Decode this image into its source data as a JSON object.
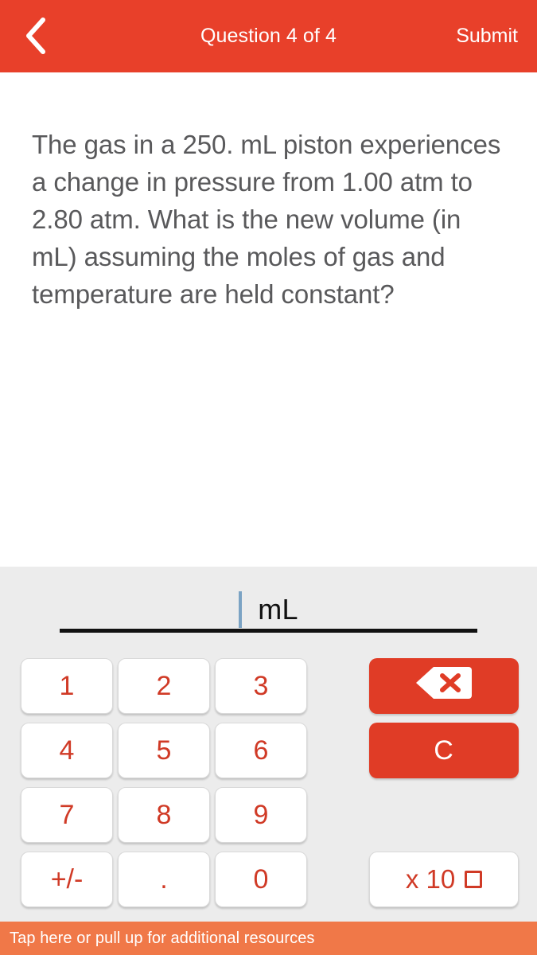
{
  "header": {
    "back_icon": "chevron-left-icon",
    "title": "Question 4 of 4",
    "submit_label": "Submit",
    "background_color": "#e8402a",
    "text_color": "#ffffff"
  },
  "question": {
    "text": "The gas in a 250. mL piston experiences a change in pressure from 1.00 atm to 2.80 atm. What is the new volume (in mL) assuming the moles of gas and temperature are held constant?",
    "text_color": "#59595b"
  },
  "answer": {
    "value": "",
    "placeholder": "",
    "unit": "mL",
    "caret_color": "#7ba3c4"
  },
  "keypad": {
    "background_color": "#ececec",
    "number_key_color": "#d03a26",
    "action_key_color": "#e03c26",
    "keys": [
      {
        "label": "1",
        "name": "key-1"
      },
      {
        "label": "2",
        "name": "key-2"
      },
      {
        "label": "3",
        "name": "key-3"
      },
      {
        "label": "4",
        "name": "key-4"
      },
      {
        "label": "5",
        "name": "key-5"
      },
      {
        "label": "6",
        "name": "key-6"
      },
      {
        "label": "7",
        "name": "key-7"
      },
      {
        "label": "8",
        "name": "key-8"
      },
      {
        "label": "9",
        "name": "key-9"
      },
      {
        "label": "+/-",
        "name": "key-sign"
      },
      {
        "label": ".",
        "name": "key-decimal"
      },
      {
        "label": "0",
        "name": "key-0"
      }
    ],
    "backspace_icon": "backspace-delete-icon",
    "clear_label": "C",
    "exponent_label": "x 10"
  },
  "bottom_bar": {
    "text": "Tap here or pull up for additional resources",
    "background_color": "#f07848",
    "text_color": "#ffffff"
  }
}
